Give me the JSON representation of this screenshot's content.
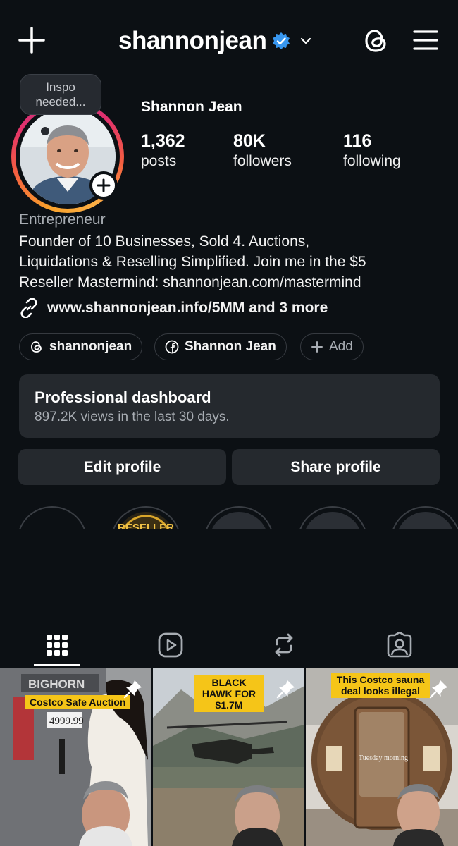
{
  "header": {
    "username": "shannonjean",
    "verified": true
  },
  "profile": {
    "note": "Inspo needed...",
    "display_name": "Shannon Jean",
    "stats": [
      {
        "value": "1,362",
        "label": "posts"
      },
      {
        "value": "80K",
        "label": "followers"
      },
      {
        "value": "116",
        "label": "following"
      }
    ],
    "category": "Entrepreneur",
    "bio_lines": [
      "Founder of 10 Businesses, Sold 4. Auctions,",
      "Liquidations & Reselling Simplified. Join me in the $5",
      "Reseller Mastermind: shannonjean.com/mastermind"
    ],
    "link": "www.shannonjean.info/5MM and 3 more"
  },
  "chips": [
    {
      "icon": "threads-icon",
      "label": "shannonjean"
    },
    {
      "icon": "facebook-icon",
      "label": "Shannon Jean"
    },
    {
      "icon": "plus-icon",
      "label": "Add"
    }
  ],
  "dashboard": {
    "title": "Professional dashboard",
    "subtitle": "897.2K views in the last 30 days."
  },
  "actions": {
    "edit": "Edit profile",
    "share": "Share profile"
  },
  "highlight_text": "RESELLER",
  "tabs": [
    "grid-icon",
    "reels-icon",
    "reposts-icon",
    "tagged-icon"
  ],
  "posts": [
    {
      "caption": "Costco Safe Auction",
      "sign": "BIGHORN",
      "price": "4999.99"
    },
    {
      "caption": "BLACK HAWK FOR $1.7M"
    },
    {
      "caption": "This Costco sauna deal looks illegal",
      "overlay": "Tuesday morning"
    }
  ],
  "colors": {
    "background": "#0c1014",
    "surface": "#25292e",
    "verified": "#3897f0",
    "caption_bg": "#f5c518"
  }
}
